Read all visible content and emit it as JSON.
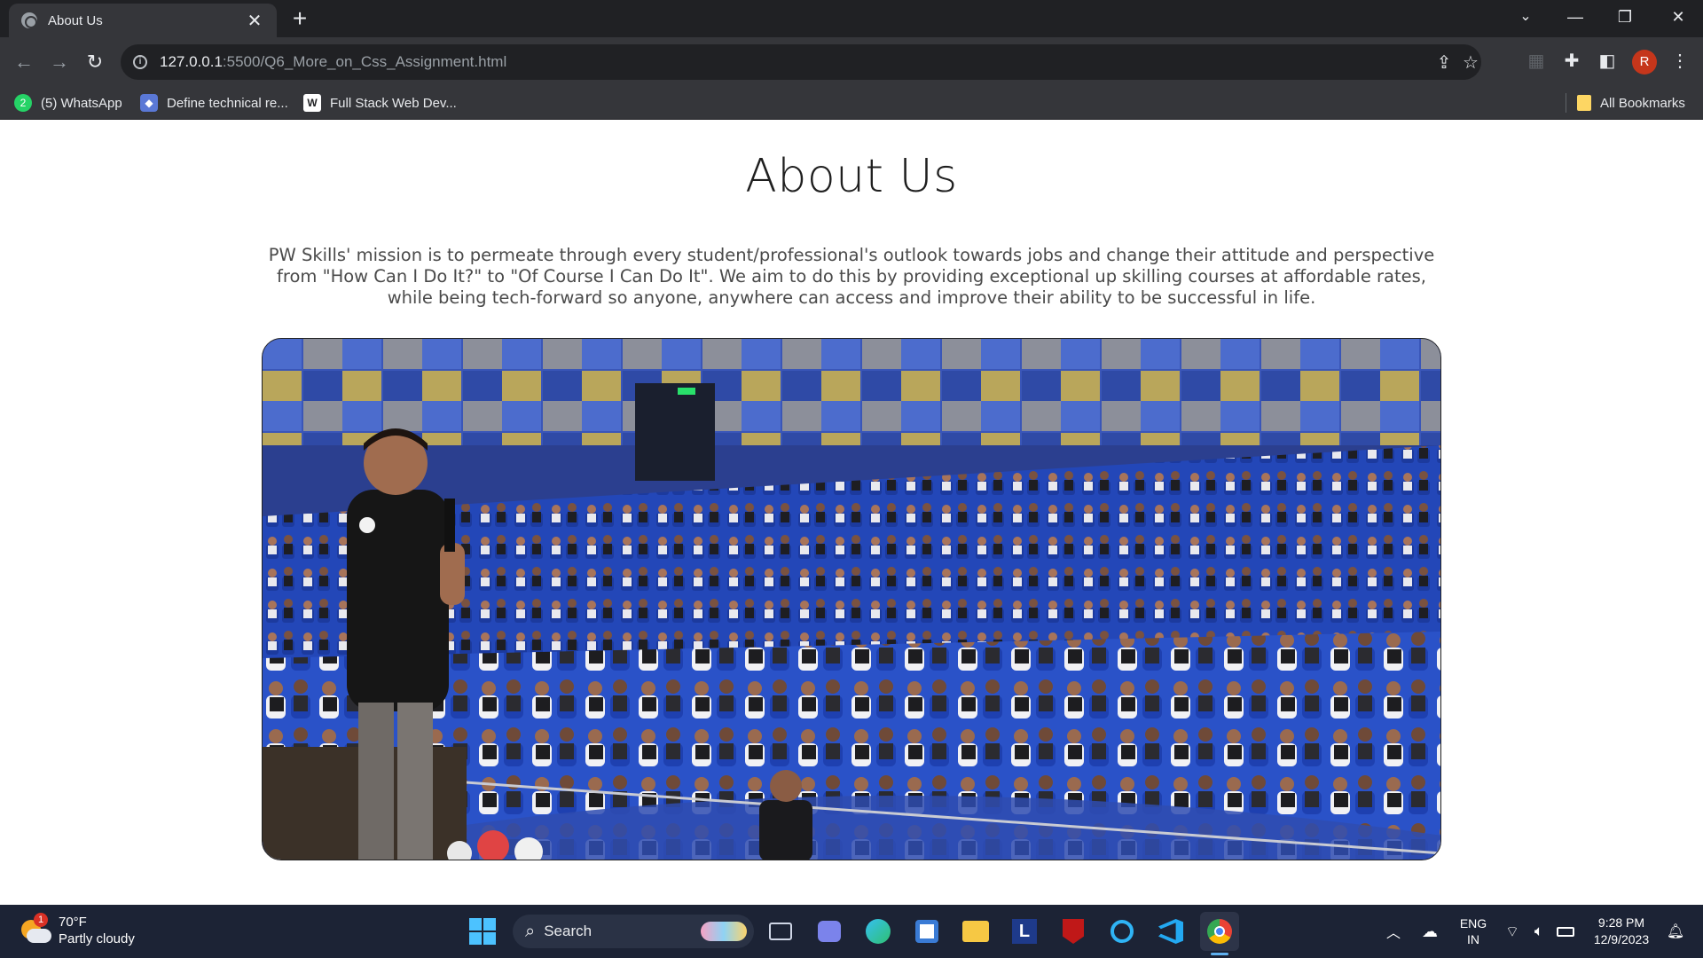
{
  "browser": {
    "tab_title": "About Us",
    "url_host": "127.0.0.1",
    "url_path": ":5500/Q6_More_on_Css_Assignment.html",
    "profile_initial": "R",
    "bookmarks": [
      {
        "label": "(5) WhatsApp",
        "badge": "2"
      },
      {
        "label": "Define technical re..."
      },
      {
        "label": "Full Stack Web Dev..."
      }
    ],
    "all_bookmarks_label": "All Bookmarks"
  },
  "page": {
    "title": "About Us",
    "mission": "PW Skills' mission is to permeate through every student/professional's outlook towards jobs and change their attitude and perspective from \"How Can I Do It?\" to \"Of Course I Can Do It\". We aim to do this by providing exceptional up skilling courses at affordable rates, while being tech-forward so anyone, anywhere can access and improve their ability to be successful in life."
  },
  "taskbar": {
    "weather_temp": "70°F",
    "weather_desc": "Partly cloudy",
    "weather_badge": "1",
    "search_label": "Search",
    "lang_line1": "ENG",
    "lang_line2": "IN",
    "time": "9:28 PM",
    "date": "12/9/2023"
  },
  "colors": {
    "chrome_dark": "#202124",
    "toolbar": "#35363a",
    "taskbar": "#1c2335",
    "avatar": "#c5361b",
    "seat_blue": "#2347b8"
  }
}
